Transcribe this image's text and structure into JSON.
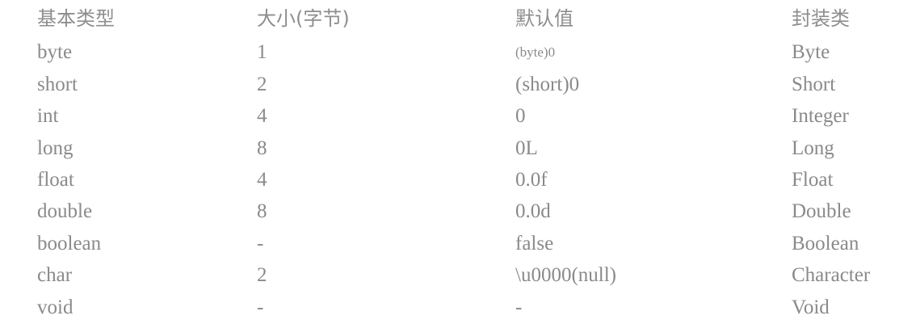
{
  "table": {
    "headers": [
      "基本类型",
      "大小(字节)",
      "默认值",
      "封装类"
    ],
    "rows": [
      [
        "byte",
        "1",
        "(byte)0",
        "Byte"
      ],
      [
        "short",
        "2",
        "(short)0",
        "Short"
      ],
      [
        "int",
        "4",
        "0",
        "Integer"
      ],
      [
        "long",
        "8",
        "0L",
        "Long"
      ],
      [
        "float",
        "4",
        "0.0f",
        "Float"
      ],
      [
        "double",
        "8",
        "0.0d",
        "Double"
      ],
      [
        "boolean",
        "-",
        "false",
        "Boolean"
      ],
      [
        "char",
        "2",
        "\\u0000(null)",
        "Character"
      ],
      [
        "void",
        "-",
        "-",
        "Void"
      ]
    ]
  }
}
